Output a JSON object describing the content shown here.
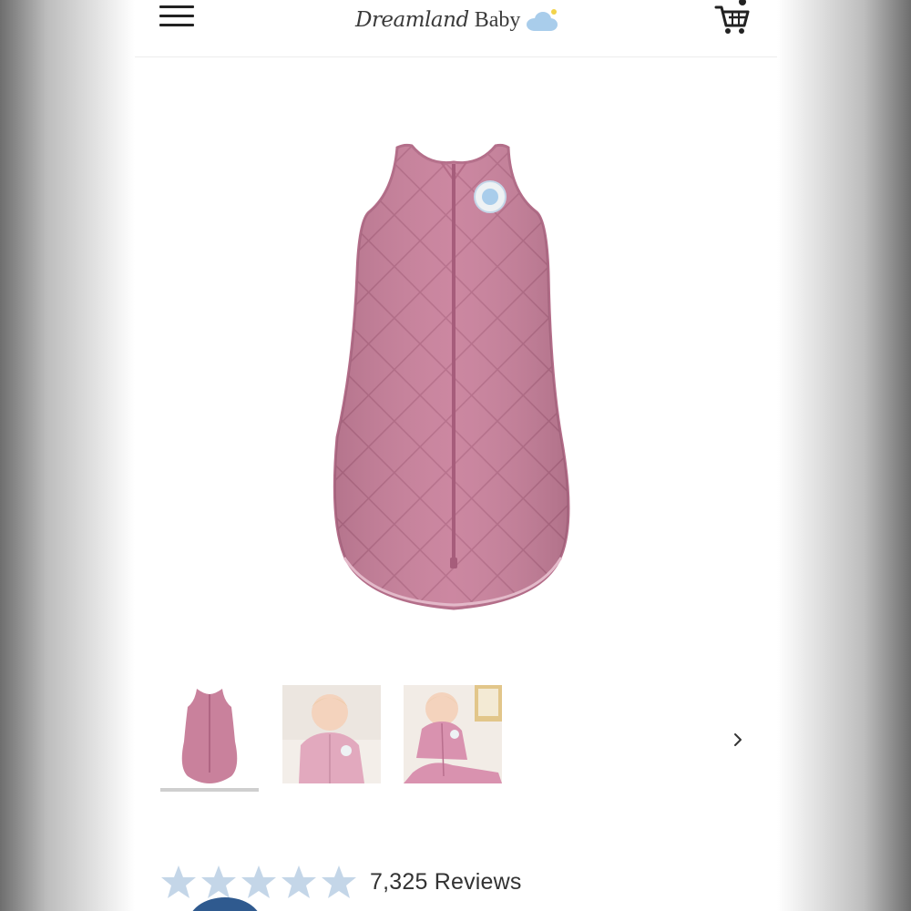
{
  "header": {
    "brand_script": "Dreamland",
    "brand_word": "Baby",
    "menu_icon": "hamburger-menu-icon",
    "cart_icon": "shopping-cart-icon"
  },
  "product": {
    "main_image": "pink quilted sleep sack",
    "thumbnails": [
      "pink quilted sleep sack",
      "baby wearing pink sleep sack close-up",
      "baby sitting in pink sleep sack"
    ],
    "selected_thumbnail": 1,
    "next_icon": "chevron-right-icon"
  },
  "reviews": {
    "count_text": "7,325 Reviews",
    "rating": 5,
    "max_rating": 5
  },
  "colors": {
    "sack_pink": "#c9819c",
    "star_blue": "#c4d6e8",
    "accent_navy": "#2f5a8f"
  }
}
